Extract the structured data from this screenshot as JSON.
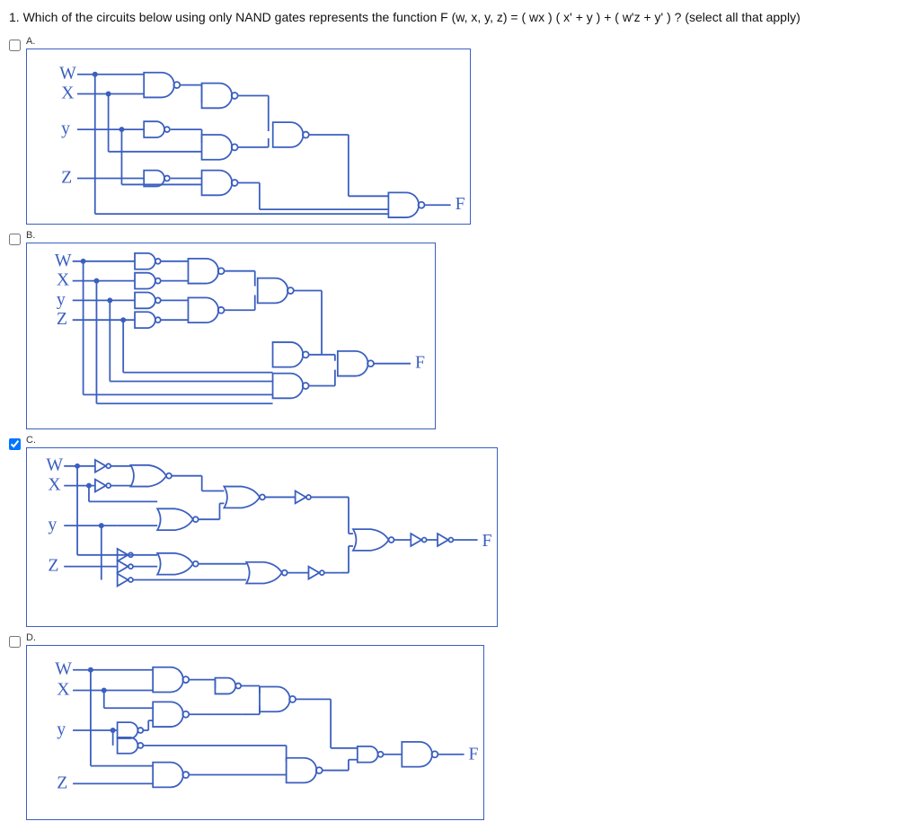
{
  "question": "1. Which of the circuits below using only NAND gates represents the function F (w, x, y, z) = ( wx ) ( x' + y ) + ( w'z + y' ) ? (select all that apply)",
  "options": {
    "a": {
      "letter": "A.",
      "inputs": [
        "W",
        "X",
        "y",
        "Z"
      ],
      "output": "F",
      "checked": false
    },
    "b": {
      "letter": "B.",
      "inputs": [
        "W",
        "X",
        "y",
        "Z"
      ],
      "output": "F",
      "checked": false
    },
    "c": {
      "letter": "C.",
      "inputs": [
        "W",
        "X",
        "y",
        "Z"
      ],
      "output": "F",
      "checked": true
    },
    "d": {
      "letter": "D.",
      "inputs": [
        "W",
        "X",
        "y",
        "Z"
      ],
      "output": "F",
      "checked": false
    }
  },
  "chart_data": {
    "type": "diagram",
    "title": "NAND gate circuit options implementing F(w,x,y,z)=(wx)(x'+y)+(w'z+y')",
    "variants": [
      "A",
      "B",
      "C",
      "D"
    ],
    "gate_type": "NAND",
    "signal_labels": [
      "W",
      "X",
      "y",
      "Z"
    ],
    "output_label": "F"
  }
}
